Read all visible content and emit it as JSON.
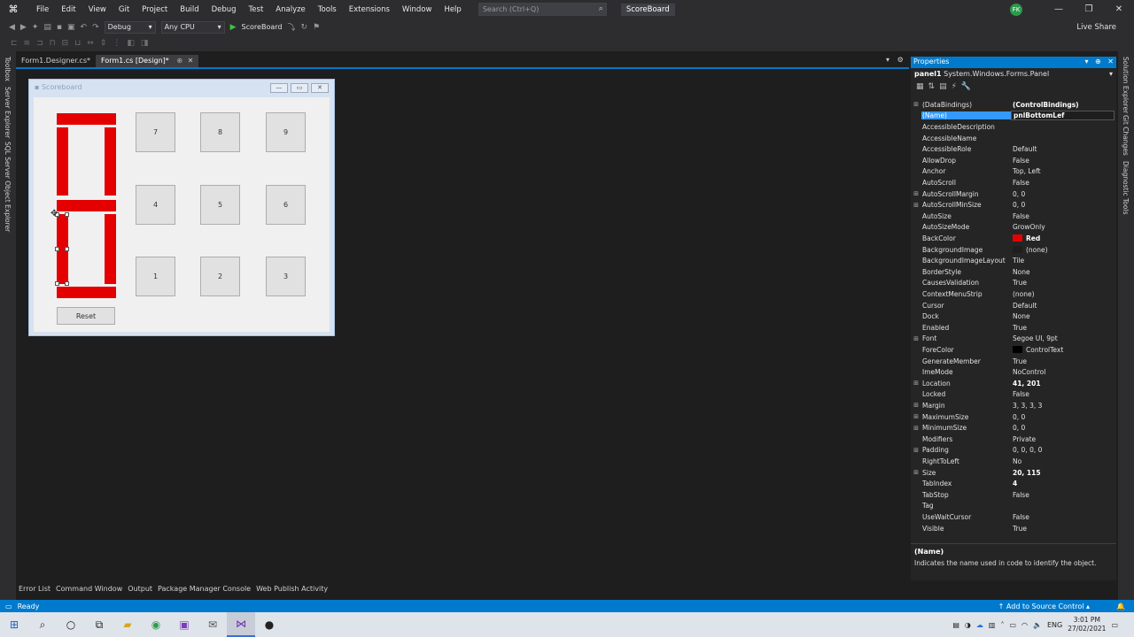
{
  "menubar": {
    "items": [
      "File",
      "Edit",
      "View",
      "Git",
      "Project",
      "Build",
      "Debug",
      "Test",
      "Analyze",
      "Tools",
      "Extensions",
      "Window",
      "Help"
    ],
    "search_placeholder": "Search (Ctrl+Q)",
    "solution_name": "ScoreBoard",
    "user_initials": "FK"
  },
  "toolbar": {
    "config": "Debug",
    "platform": "Any CPU",
    "run_label": "ScoreBoard",
    "live_share": "Live Share"
  },
  "left_rail": [
    "Toolbox",
    "Server Explorer",
    "SQL Server Object Explorer"
  ],
  "right_rail": [
    "Solution Explorer",
    "Git Changes",
    "Diagnostic Tools"
  ],
  "doc_tabs": [
    {
      "label": "Form1.Designer.cs*"
    },
    {
      "label": "Form1.cs [Design]*"
    }
  ],
  "form": {
    "title": "Scoreboard",
    "keys": [
      "7",
      "8",
      "9",
      "4",
      "5",
      "6",
      "1",
      "2",
      "3"
    ],
    "reset_label": "Reset",
    "segment_color": "#e40000"
  },
  "properties": {
    "header": "Properties",
    "object_name": "panel1",
    "object_type": "System.Windows.Forms.Panel",
    "rows": [
      {
        "name": "(DataBindings)",
        "value": "(ControlBindings)",
        "expand": true,
        "bold": true
      },
      {
        "name": "(Name)",
        "value": "pnlBottomLef",
        "selected": true,
        "edit": true
      },
      {
        "name": "AccessibleDescription",
        "value": ""
      },
      {
        "name": "AccessibleName",
        "value": ""
      },
      {
        "name": "AccessibleRole",
        "value": "Default"
      },
      {
        "name": "AllowDrop",
        "value": "False"
      },
      {
        "name": "Anchor",
        "value": "Top, Left"
      },
      {
        "name": "AutoScroll",
        "value": "False"
      },
      {
        "name": "AutoScrollMargin",
        "value": "0, 0",
        "expand": true
      },
      {
        "name": "AutoScrollMinSize",
        "value": "0, 0",
        "expand": true
      },
      {
        "name": "AutoSize",
        "value": "False"
      },
      {
        "name": "AutoSizeMode",
        "value": "GrowOnly"
      },
      {
        "name": "BackColor",
        "value": "Red",
        "swatch": "#e40000",
        "bold": true
      },
      {
        "name": "BackgroundImage",
        "value": "(none)",
        "swatch": "#1e1e1e"
      },
      {
        "name": "BackgroundImageLayout",
        "value": "Tile"
      },
      {
        "name": "BorderStyle",
        "value": "None"
      },
      {
        "name": "CausesValidation",
        "value": "True"
      },
      {
        "name": "ContextMenuStrip",
        "value": "(none)"
      },
      {
        "name": "Cursor",
        "value": "Default"
      },
      {
        "name": "Dock",
        "value": "None"
      },
      {
        "name": "Enabled",
        "value": "True"
      },
      {
        "name": "Font",
        "value": "Segoe UI, 9pt",
        "expand": true
      },
      {
        "name": "ForeColor",
        "value": "ControlText",
        "swatch": "#000000"
      },
      {
        "name": "GenerateMember",
        "value": "True"
      },
      {
        "name": "ImeMode",
        "value": "NoControl"
      },
      {
        "name": "Location",
        "value": "41, 201",
        "expand": true,
        "bold": true
      },
      {
        "name": "Locked",
        "value": "False"
      },
      {
        "name": "Margin",
        "value": "3, 3, 3, 3",
        "expand": true
      },
      {
        "name": "MaximumSize",
        "value": "0, 0",
        "expand": true
      },
      {
        "name": "MinimumSize",
        "value": "0, 0",
        "expand": true
      },
      {
        "name": "Modifiers",
        "value": "Private"
      },
      {
        "name": "Padding",
        "value": "0, 0, 0, 0",
        "expand": true
      },
      {
        "name": "RightToLeft",
        "value": "No"
      },
      {
        "name": "Size",
        "value": "20, 115",
        "expand": true,
        "bold": true
      },
      {
        "name": "TabIndex",
        "value": "4",
        "bold": true
      },
      {
        "name": "TabStop",
        "value": "False"
      },
      {
        "name": "Tag",
        "value": ""
      },
      {
        "name": "UseWaitCursor",
        "value": "False"
      },
      {
        "name": "Visible",
        "value": "True"
      }
    ],
    "desc_title": "(Name)",
    "desc_text": "Indicates the name used in code to identify the object."
  },
  "bottom_tabs": [
    "Error List",
    "Command Window",
    "Output",
    "Package Manager Console",
    "Web Publish Activity"
  ],
  "status": {
    "left": "Ready",
    "source_control": "Add to Source Control"
  },
  "taskbar": {
    "lang": "ENG",
    "time": "3:01 PM",
    "date": "27/02/2021"
  },
  "colors": {
    "accent": "#007acc",
    "ide_bg": "#1e1e1e"
  }
}
